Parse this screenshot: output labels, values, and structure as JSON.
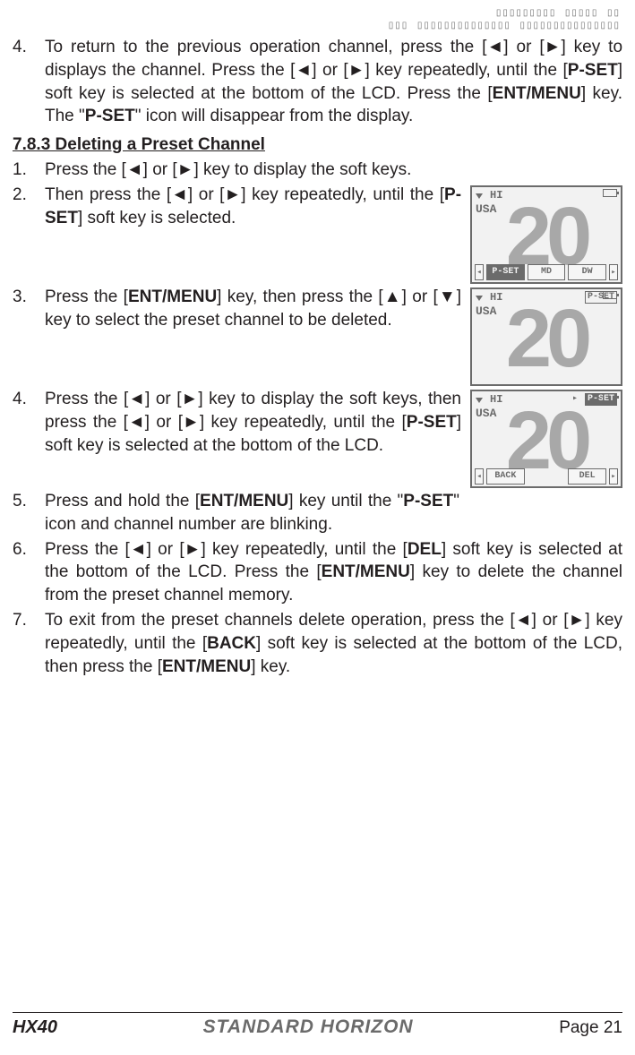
{
  "placeholder_top": "▯▯▯▯▯▯▯▯▯  ▯▯▯▯▯  ▯▯\n▯▯▯  ▯▯▯▯▯▯▯▯▯▯▯▯▯▯  ▯▯▯▯▯▯▯▯▯▯▯▯▯▯▯",
  "prev_section": {
    "items": [
      {
        "num": "4.",
        "parts": [
          {
            "t": "To return to the previous operation channel, press the ["
          },
          {
            "sym": "◄"
          },
          {
            "t": "] or ["
          },
          {
            "sym": "►"
          },
          {
            "t": "] key to displays the channel. Press the ["
          },
          {
            "sym": "◄"
          },
          {
            "t": "] or ["
          },
          {
            "sym": "►"
          },
          {
            "t": "] key repeatedly, until the ["
          },
          {
            "b": "P-SET"
          },
          {
            "t": "] soft key is selected at the bottom of the LCD. Press the ["
          },
          {
            "b": "ENT/MENU"
          },
          {
            "t": "] key. The \""
          },
          {
            "b": "P-SET"
          },
          {
            "t": "\" icon will disappear from the display."
          }
        ]
      }
    ]
  },
  "section_heading": "7.8.3 Deleting a Preset Channel",
  "steps": [
    {
      "num": "1.",
      "parts": [
        {
          "t": "Press the ["
        },
        {
          "sym": "◄"
        },
        {
          "t": "] or ["
        },
        {
          "sym": "►"
        },
        {
          "t": "] key to display the soft keys."
        }
      ]
    },
    {
      "num": "2.",
      "has_lcd": "lcd1",
      "parts": [
        {
          "t": "Then press the ["
        },
        {
          "sym": "◄"
        },
        {
          "t": "] or ["
        },
        {
          "sym": "►"
        },
        {
          "t": "] key repeatedly, until the ["
        },
        {
          "b": "P-SET"
        },
        {
          "t": "] soft key is selected."
        }
      ]
    },
    {
      "num": "3.",
      "has_lcd": "lcd2",
      "parts": [
        {
          "t": "Press the ["
        },
        {
          "b": "ENT/MENU"
        },
        {
          "t": "] key, then press the ["
        },
        {
          "sym": "▲"
        },
        {
          "t": "] or ["
        },
        {
          "sym": "▼"
        },
        {
          "t": "] key to select the preset channel to be deleted."
        }
      ]
    },
    {
      "num": "4.",
      "has_lcd": "lcd3",
      "parts": [
        {
          "t": "Press the ["
        },
        {
          "sym": "◄"
        },
        {
          "t": "] or ["
        },
        {
          "sym": "►"
        },
        {
          "t": "] key to display the soft keys, then press the ["
        },
        {
          "sym": "◄"
        },
        {
          "t": "] or ["
        },
        {
          "sym": "►"
        },
        {
          "t": "] key repeatedly, until the ["
        },
        {
          "b": "P-SET"
        },
        {
          "t": "] soft key is selected at the bottom of the LCD."
        }
      ]
    },
    {
      "num": "5.",
      "parts": [
        {
          "t": "Press and hold the ["
        },
        {
          "b": "ENT/MENU"
        },
        {
          "t": "] key until the \""
        },
        {
          "b": "P-SET"
        },
        {
          "t": "\" icon and channel number are blinking."
        }
      ],
      "narrow": true
    },
    {
      "num": "6.",
      "parts": [
        {
          "t": "Press the ["
        },
        {
          "sym": "◄"
        },
        {
          "t": "] or ["
        },
        {
          "sym": "►"
        },
        {
          "t": "] key repeatedly, until the ["
        },
        {
          "b": "DEL"
        },
        {
          "t": "] soft key is selected at the bottom of the LCD. Press the ["
        },
        {
          "b": "ENT/MENU"
        },
        {
          "t": "] key to delete the channel from the preset channel memory."
        }
      ]
    },
    {
      "num": "7.",
      "parts": [
        {
          "t": "To exit from the preset channels delete operation, press the ["
        },
        {
          "sym": "◄"
        },
        {
          "t": "] or ["
        },
        {
          "sym": "►"
        },
        {
          "t": "] key repeatedly, until the ["
        },
        {
          "b": "BACK"
        },
        {
          "t": "] soft key is selected at the bottom of the LCD, then press the ["
        },
        {
          "b": "ENT/MENU"
        },
        {
          "t": "] key."
        }
      ]
    }
  ],
  "lcd": {
    "lcd1": {
      "region": "USA",
      "hi": "HI",
      "pset_top": "",
      "channel": "20",
      "softkeys": [
        {
          "label": "P-SET",
          "selected": true
        },
        {
          "label": "MD",
          "selected": false
        },
        {
          "label": "DW",
          "selected": false
        }
      ],
      "arrows": true
    },
    "lcd2": {
      "region": "USA",
      "hi": "HI",
      "pset_top": "P-SET",
      "pset_top_selected": false,
      "channel": "20",
      "softkeys": [],
      "arrows": false
    },
    "lcd3": {
      "region": "USA",
      "hi": "HI",
      "pset_top": "P-SET",
      "pset_top_selected": true,
      "pset_top_icon": true,
      "channel": "20",
      "softkeys": [
        {
          "label": "BACK",
          "selected": false
        },
        {
          "label": "",
          "selected": false,
          "blank": true
        },
        {
          "label": "DEL",
          "selected": false
        }
      ],
      "arrows": true,
      "arrows_only_sides": true
    }
  },
  "footer": {
    "model": "HX40",
    "brand": "STANDARD HORIZON",
    "page": "Page 21"
  }
}
